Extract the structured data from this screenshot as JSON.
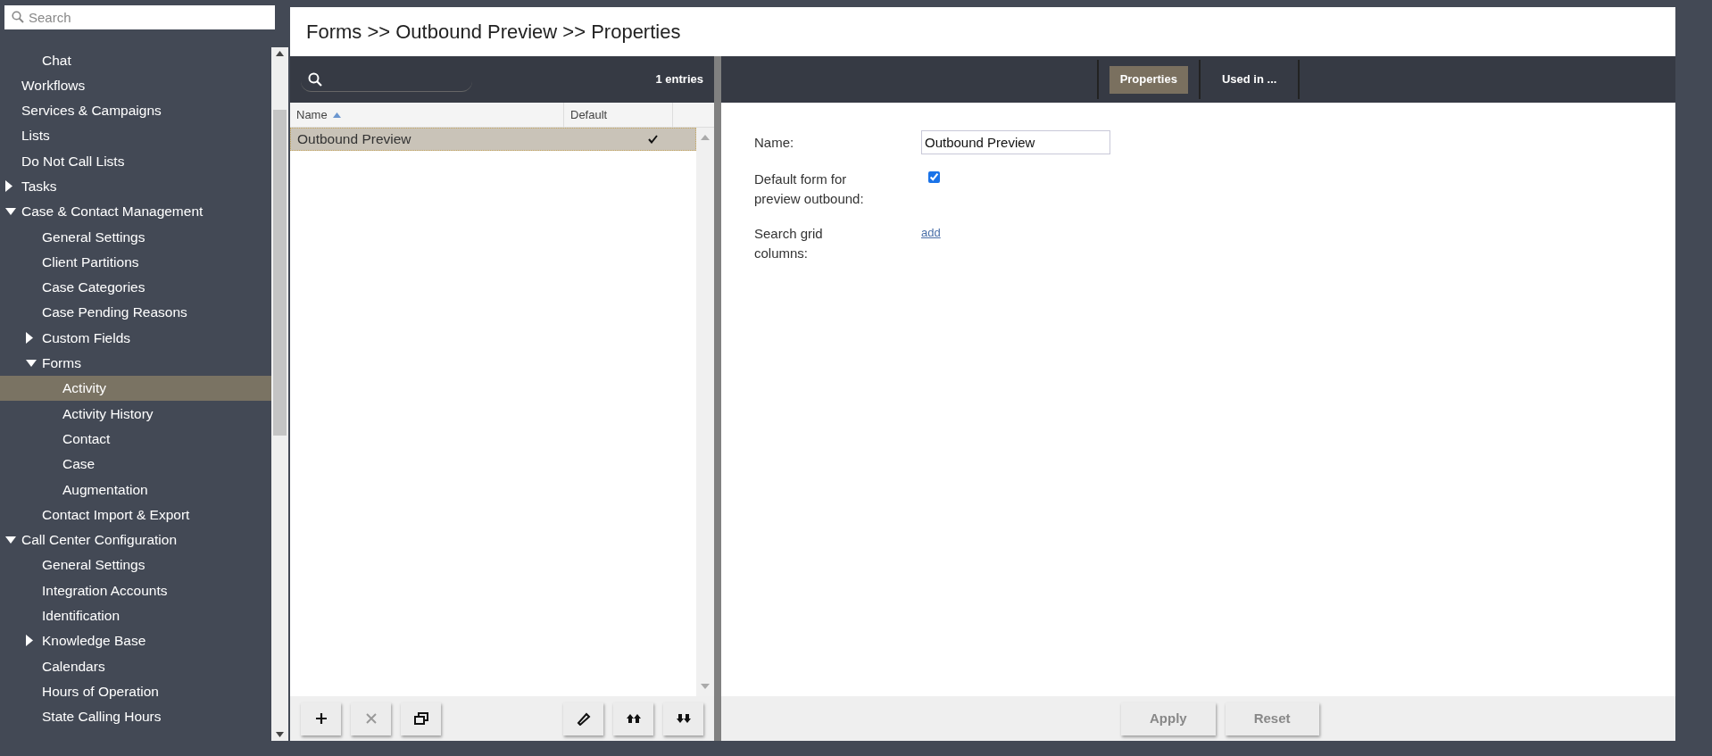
{
  "sidebar": {
    "search": {
      "placeholder": "Search"
    },
    "tree": [
      {
        "children": [
          {
            "label": "Chat",
            "selected": false
          }
        ]
      },
      {
        "label": "Workflows",
        "selected": false
      },
      {
        "label": "Services & Campaigns",
        "selected": false
      },
      {
        "label": "Lists",
        "selected": false
      },
      {
        "label": "Do Not Call Lists",
        "selected": false
      },
      {
        "label": "Tasks",
        "selected": false,
        "expanded": false
      },
      {
        "label": "Case & Contact Management",
        "selected": false,
        "expanded": true,
        "children": [
          {
            "label": "General Settings",
            "selected": false
          },
          {
            "label": "Client Partitions",
            "selected": false
          },
          {
            "label": "Case Categories",
            "selected": false
          },
          {
            "label": "Case Pending Reasons",
            "selected": false
          },
          {
            "label": "Custom Fields",
            "selected": false,
            "expanded": false
          },
          {
            "label": "Forms",
            "selected": false,
            "expanded": true,
            "children": [
              {
                "label": "Activity",
                "selected": true
              },
              {
                "label": "Activity History",
                "selected": false
              },
              {
                "label": "Contact",
                "selected": false
              },
              {
                "label": "Case",
                "selected": false
              },
              {
                "label": "Augmentation",
                "selected": false
              }
            ]
          },
          {
            "label": "Contact Import & Export",
            "selected": false
          }
        ]
      },
      {
        "label": "Call Center Configuration",
        "selected": false,
        "expanded": true,
        "children": [
          {
            "label": "General Settings",
            "selected": false
          },
          {
            "label": "Integration Accounts",
            "selected": false
          },
          {
            "label": "Identification",
            "selected": false
          },
          {
            "label": "Knowledge Base",
            "selected": false,
            "expanded": false
          },
          {
            "label": "Calendars",
            "selected": false
          },
          {
            "label": "Hours of Operation",
            "selected": false
          },
          {
            "label": "State Calling Hours",
            "selected": false
          }
        ]
      }
    ]
  },
  "title": "Forms >> Outbound Preview >> Properties",
  "list": {
    "entries": "1 entries",
    "columns": [
      {
        "label": "Name",
        "sorted": true
      },
      {
        "label": "Default",
        "sorted": false
      }
    ],
    "rows": [
      {
        "name": "Outbound Preview",
        "default": true,
        "selected": true
      }
    ],
    "buttons": [
      {
        "kind": "add",
        "disabled": false
      },
      {
        "kind": "delete",
        "disabled": true
      },
      {
        "kind": "copy",
        "disabled": false
      },
      {
        "kind": "edit",
        "disabled": false
      },
      {
        "kind": "up",
        "disabled": false
      },
      {
        "kind": "down",
        "disabled": false
      }
    ]
  },
  "tabs": [
    {
      "label": "Properties",
      "selected": true
    },
    {
      "label": "Used in ...",
      "selected": false
    }
  ],
  "form": {
    "fields": [
      {
        "kind": "text",
        "label": "Name:",
        "value": "Outbound Preview"
      },
      {
        "kind": "checkbox",
        "label": "Default form for preview outbound:",
        "checked": true
      },
      {
        "kind": "link",
        "label": "Search grid columns:",
        "link": "add"
      }
    ]
  },
  "actions": [
    "Apply",
    "Reset"
  ]
}
